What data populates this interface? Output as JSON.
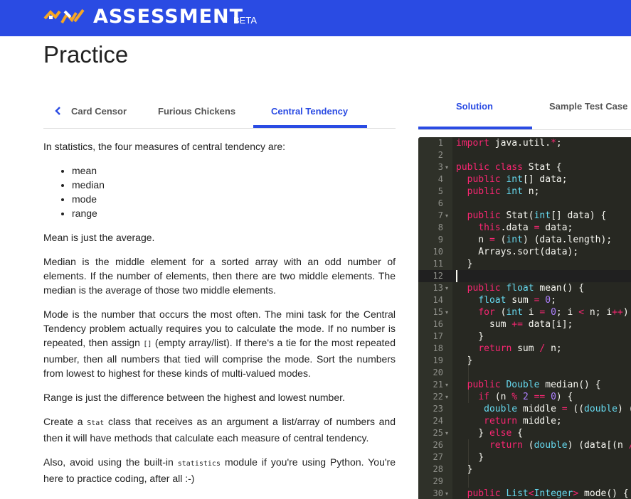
{
  "header": {
    "brand": "ASSESSMENT",
    "badge": "BETA",
    "brand_color": "#2a4be3"
  },
  "page": {
    "title": "Practice"
  },
  "problem_tabs": [
    "Card Censor",
    "Furious Chickens",
    "Central Tendency"
  ],
  "active_problem_tab": "Central Tendency",
  "description": {
    "intro": "In statistics, the four measures of central tendency are:",
    "measures": [
      "mean",
      "median",
      "mode",
      "range"
    ],
    "mean": "Mean is just the average.",
    "median": "Median is the middle element for a sorted array with an odd number of elements. If the number of elements, then there are two middle elements. The median is the average of those two middle elements.",
    "mode_part1": "Mode is the number that occurs the most often. The mini task for the Central Tendency problem actually requires you to calculate the mode. If no number is repeated, then assign ",
    "mode_code": "[]",
    "mode_part2": " (empty array/list). If there's a tie for the most repeated number, then all numbers that tied will comprise the mode. Sort the numbers from lowest to highest for these kinds of multi-valued modes.",
    "range": "Range is just the difference between the highest and lowest number.",
    "create_part1": "Create a ",
    "create_code": "Stat",
    "create_part2": " class that receives as an argument a list/array of numbers and then it will have methods that calculate each measure of central tendency.",
    "avoid_part1": "Also, avoid using the built-in ",
    "avoid_code": "statistics",
    "avoid_part2": " module if you're using Python. You're here to practice coding, after all :-)"
  },
  "editor_tabs": [
    "Solution",
    "Sample Test Case"
  ],
  "active_editor_tab": "Solution",
  "editor": {
    "cursor_line": 12,
    "lines": [
      "import java.util.*;",
      "",
      "public class Stat {",
      "  public int[] data;",
      "  public int n;",
      "",
      "  public Stat(int[] data) {",
      "    this.data = data;",
      "    n = (int) (data.length);",
      "    Arrays.sort(data);",
      "  }",
      "",
      "  public float mean() {",
      "    float sum = 0;",
      "    for (int i = 0; i < n; i++) {",
      "      sum += data[i];",
      "    }",
      "    return sum / n;",
      "  }",
      "",
      "  public Double median() {",
      "    if (n % 2 == 0) {",
      "     double middle = ((double) (",
      "     return middle;",
      "    } else {",
      "      return (double) (data[(n /",
      "    }",
      "  }",
      "",
      "  public List<Integer> mode() {"
    ],
    "fold_lines": [
      3,
      7,
      13,
      15,
      21,
      22,
      25,
      30
    ],
    "colors": {
      "background": "#272822",
      "gutter": "#2f3129",
      "keyword": "#f92672",
      "type": "#66d9ef",
      "number": "#ae81ff",
      "text": "#f8f8f2"
    }
  }
}
